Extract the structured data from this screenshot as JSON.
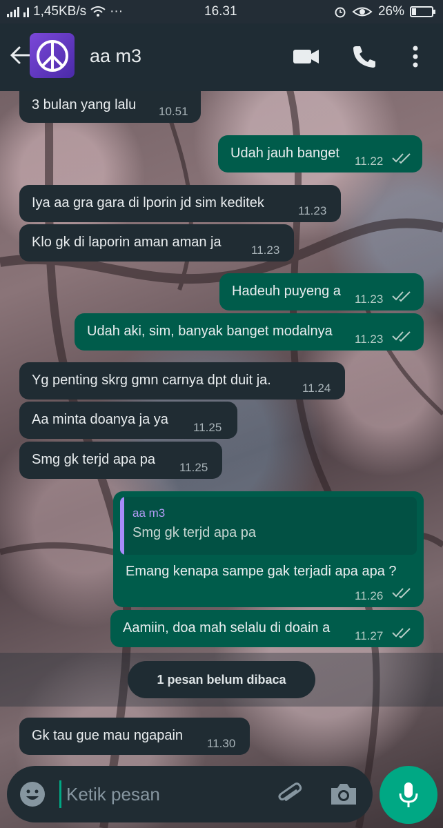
{
  "status_bar": {
    "network_speed": "1,45KB/s",
    "dots": "···",
    "clock": "16.31",
    "battery_percent": "26%",
    "battery_level": 0.26
  },
  "header": {
    "contact_name": "aa m3",
    "icons": [
      "back-arrow-icon",
      "peace-sign-avatar",
      "video-call-icon",
      "phone-icon",
      "more-vert-icon"
    ]
  },
  "messages": [
    {
      "dir": "in",
      "text": "3 bulan yang lalu",
      "time": "10.51"
    },
    {
      "dir": "out",
      "text": "Udah jauh banget",
      "time": "11.22"
    },
    {
      "dir": "in",
      "text": "Iya aa gra gara di lporin jd sim keditek",
      "time": "11.23"
    },
    {
      "dir": "in",
      "text": "Klo gk di laporin aman aman ja",
      "time": "11.23"
    },
    {
      "dir": "out",
      "text": "Hadeuh puyeng a",
      "time": "11.23"
    },
    {
      "dir": "out",
      "text": "Udah aki, sim, banyak banget modalnya",
      "time": "11.23"
    },
    {
      "dir": "in",
      "text": "Yg penting skrg gmn carnya dpt duit ja.",
      "time": "11.24"
    },
    {
      "dir": "in",
      "text": "Aa minta doanya ja ya",
      "time": "11.25"
    },
    {
      "dir": "in",
      "text": "Smg gk terjd apa pa",
      "time": "11.25"
    },
    {
      "dir": "out",
      "quote_name": "aa m3",
      "quote_text": "Smg gk terjd apa pa",
      "text": "Emang kenapa sampe gak terjadi apa apa ?",
      "time": "11.26"
    },
    {
      "dir": "out",
      "text": "Aamiin, doa mah selalu di doain a",
      "time": "11.27"
    },
    {
      "dir": "in",
      "text": "Gk tau gue mau ngapain",
      "time": "11.30"
    }
  ],
  "unread_banner": "1 pesan belum dibaca",
  "composer": {
    "placeholder": "Ketik pesan",
    "icons": [
      "emoji-icon",
      "attach-icon",
      "camera-icon",
      "mic-icon"
    ]
  },
  "colors": {
    "incoming_bubble": "#202c33",
    "outgoing_bubble": "#005c4b",
    "accent": "#00a884",
    "read_ticks": "#b7cdc7"
  }
}
